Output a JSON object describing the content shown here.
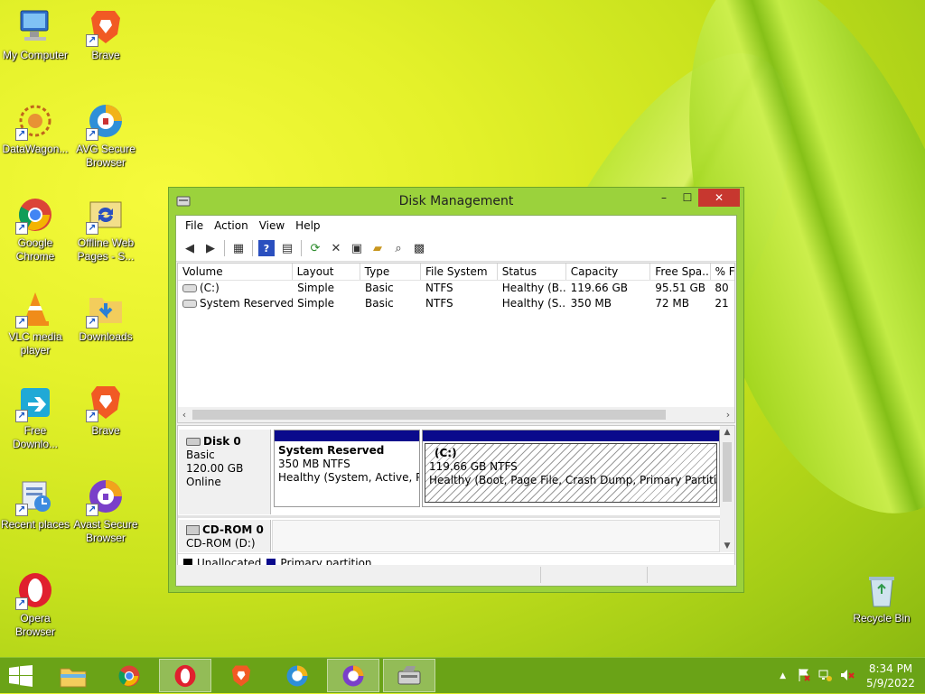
{
  "desktop": {
    "icons": [
      {
        "label": "My Computer"
      },
      {
        "label": "Brave"
      },
      {
        "label": "DataWagon..."
      },
      {
        "label": "AVG Secure Browser"
      },
      {
        "label": "Google Chrome"
      },
      {
        "label": "Offline Web Pages - S..."
      },
      {
        "label": "VLC media player"
      },
      {
        "label": "Downloads"
      },
      {
        "label": "Free Downlo..."
      },
      {
        "label": "Brave"
      },
      {
        "label": "Recent places"
      },
      {
        "label": "Avast Secure Browser"
      },
      {
        "label": "Opera Browser"
      },
      {
        "label": "Recycle Bin"
      }
    ]
  },
  "window": {
    "title": "Disk Management",
    "menu": [
      "File",
      "Action",
      "View",
      "Help"
    ],
    "controls": {
      "minimize": "–",
      "maximize": "☐",
      "close": "✕"
    }
  },
  "volume_list": {
    "columns": [
      "Volume",
      "Layout",
      "Type",
      "File System",
      "Status",
      "Capacity",
      "Free Spa...",
      "% F"
    ],
    "rows": [
      {
        "volume": "(C:)",
        "layout": "Simple",
        "type": "Basic",
        "fs": "NTFS",
        "status": "Healthy (B...",
        "capacity": "119.66 GB",
        "free": "95.51 GB",
        "pct": "80"
      },
      {
        "volume": "System Reserved",
        "layout": "Simple",
        "type": "Basic",
        "fs": "NTFS",
        "status": "Healthy (S...",
        "capacity": "350 MB",
        "free": "72 MB",
        "pct": "21"
      }
    ]
  },
  "disks": {
    "disk0": {
      "name": "Disk 0",
      "type": "Basic",
      "size": "120.00 GB",
      "state": "Online"
    },
    "cdrom0": {
      "name": "CD-ROM 0",
      "sub": "CD-ROM (D:)"
    },
    "partitions": [
      {
        "name": "System Reserved",
        "size": "350 MB NTFS",
        "status": "Healthy (System, Active, Prir"
      },
      {
        "name": "(C:)",
        "size": "119.66 GB NTFS",
        "status": "Healthy (Boot, Page File, Crash Dump, Primary Partition)"
      }
    ]
  },
  "legend": {
    "unallocated": "Unallocated",
    "primary": "Primary partition",
    "colors": {
      "unallocated": "#000000",
      "primary": "#0a0a8c"
    }
  },
  "taskbar": {
    "time": "8:34 PM",
    "date": "5/9/2022"
  }
}
